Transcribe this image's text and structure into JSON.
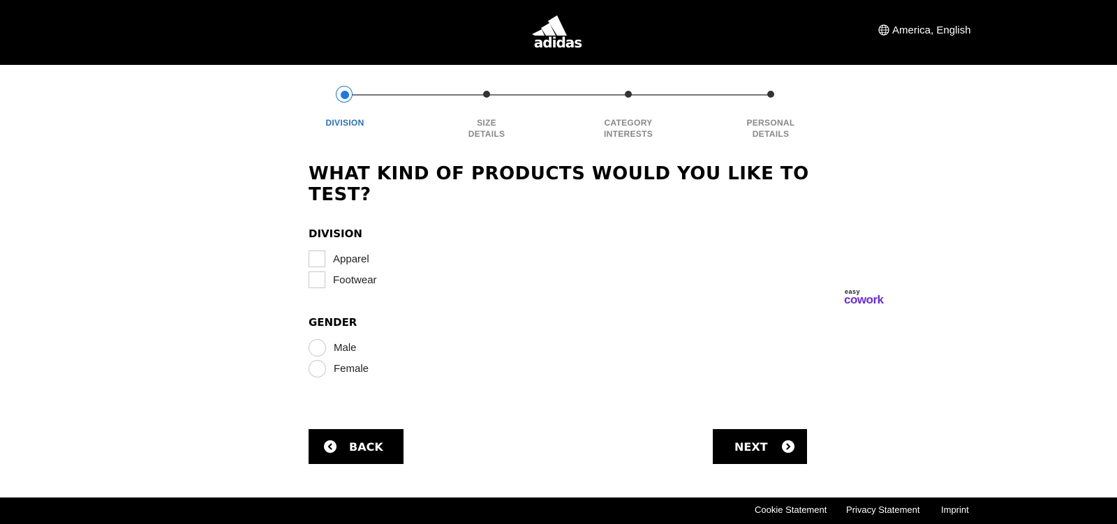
{
  "header": {
    "logo_text": "adidas",
    "locale": "America, English"
  },
  "stepper": {
    "steps": [
      {
        "line1": "DIVISION",
        "line2": "",
        "active": true
      },
      {
        "line1": "SIZE",
        "line2": "DETAILS",
        "active": false
      },
      {
        "line1": "CATEGORY",
        "line2": "INTERESTS",
        "active": false
      },
      {
        "line1": "PERSONAL",
        "line2": "DETAILS",
        "active": false
      }
    ]
  },
  "form": {
    "question": "WHAT KIND OF PRODUCTS WOULD YOU LIKE TO TEST?",
    "division": {
      "title": "DIVISION",
      "options": [
        "Apparel",
        "Footwear"
      ]
    },
    "gender": {
      "title": "GENDER",
      "options": [
        "Male",
        "Female"
      ]
    }
  },
  "buttons": {
    "back": "BACK",
    "next": "NEXT"
  },
  "watermark": {
    "line1": "easy",
    "line2": "cowork"
  },
  "footer": {
    "links": [
      "Cookie Statement",
      "Privacy Statement",
      "Imprint"
    ]
  },
  "colors": {
    "active_step": "#1f7ae0",
    "watermark": "#6a2fd0",
    "header_bg": "#000000"
  }
}
